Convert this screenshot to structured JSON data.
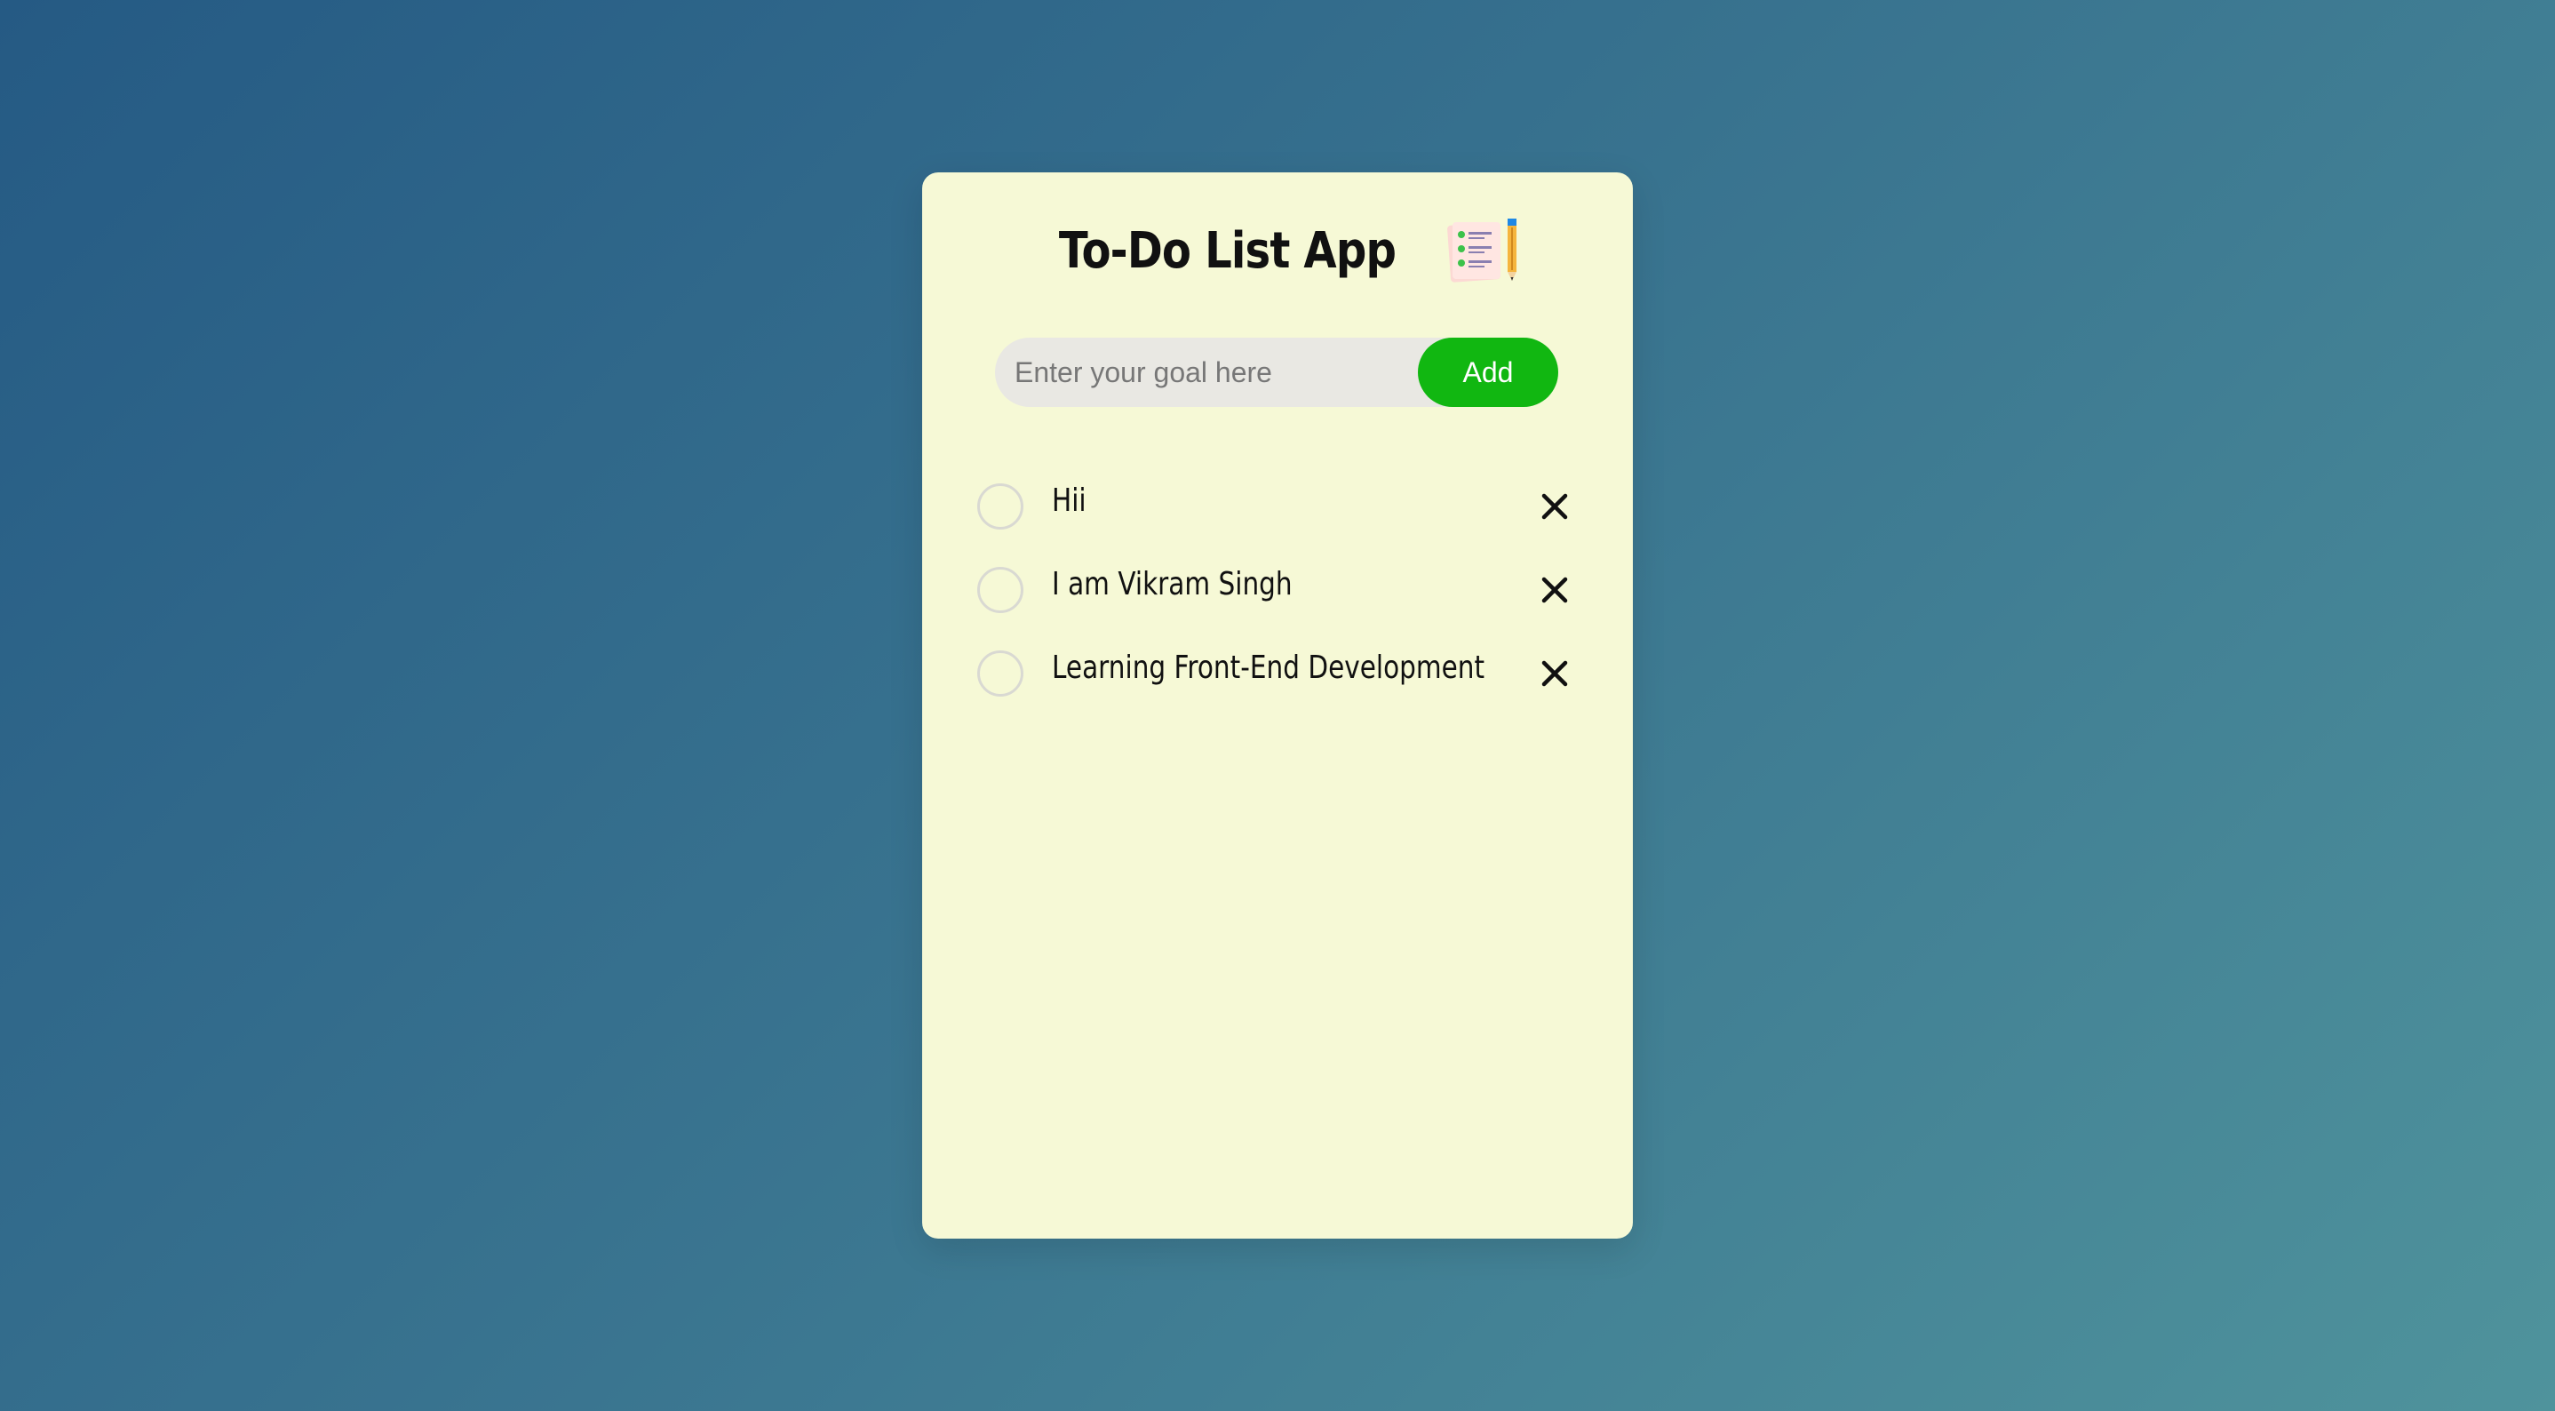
{
  "app": {
    "title": "To-Do List App",
    "title_icon": "notepad-checklist-pencil-icon"
  },
  "input": {
    "placeholder": "Enter your goal here",
    "value": ""
  },
  "add_button": {
    "label": "Add"
  },
  "tasks": [
    {
      "text": "Hii",
      "checked": false
    },
    {
      "text": "I am Vikram Singh",
      "checked": false
    },
    {
      "text": "Learning Front-End Development",
      "checked": false
    }
  ],
  "colors": {
    "background_start": "#255a84",
    "background_end": "#4f939c",
    "card": "#f6f9d6",
    "add_button": "#11b711",
    "input_bg": "#e9e8e3"
  },
  "icons": {
    "check": "circle-checkbox-icon",
    "delete": "close-icon"
  }
}
